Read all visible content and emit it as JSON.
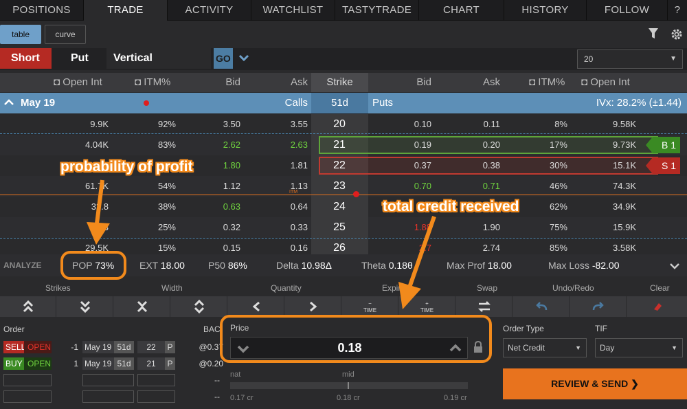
{
  "nav": {
    "tabs": [
      "POSITIONS",
      "TRADE",
      "ACTIVITY",
      "WATCHLIST",
      "TASTYTRADE",
      "CHART",
      "HISTORY",
      "FOLLOW",
      "?"
    ],
    "active": "TRADE"
  },
  "view": {
    "table": "table",
    "curve": "curve"
  },
  "strategy": {
    "short": "Short",
    "put": "Put",
    "vertical": "Vertical",
    "go": "GO",
    "strikes_count": "20"
  },
  "chain_header": {
    "open_int": "Open Int",
    "itm": "ITM%",
    "bid": "Bid",
    "ask": "Ask",
    "strike": "Strike",
    "put_bid": "Bid",
    "put_ask": "Ask",
    "put_itm": "ITM%",
    "put_open_int": "Open Int"
  },
  "expiry": {
    "date": "May 19",
    "calls": "Calls",
    "dte": "51d",
    "puts": "Puts",
    "ivx": "IVx: 28.2% (±1.44)"
  },
  "rows": [
    {
      "c_oi": "9.9K",
      "c_itm": "92%",
      "c_bid": "3.50",
      "c_ask": "3.55",
      "strike": "20",
      "p_bid": "0.10",
      "p_ask": "0.11",
      "p_itm": "8%",
      "p_oi": "9.58K",
      "pos": ""
    },
    {
      "c_oi": "4.04K",
      "c_itm": "83%",
      "c_bid": "2.62",
      "c_ask": "2.63",
      "strike": "21",
      "p_bid": "0.19",
      "p_ask": "0.20",
      "p_itm": "17%",
      "p_oi": "9.73K",
      "pos": "B 1"
    },
    {
      "c_oi": "",
      "c_itm": "",
      "c_bid": "1.80",
      "c_ask": "1.81",
      "strike": "22",
      "p_bid": "0.37",
      "p_ask": "0.38",
      "p_itm": "30%",
      "p_oi": "15.1K",
      "pos": "S 1"
    },
    {
      "c_oi": "61.7K",
      "c_itm": "54%",
      "c_bid": "1.12",
      "c_ask": "1.13",
      "strike": "23",
      "p_bid": "0.70",
      "p_ask": "0.71",
      "p_itm": "46%",
      "p_oi": "74.3K",
      "pos": ""
    },
    {
      "c_oi": "32.8",
      "c_itm": "38%",
      "c_bid": "0.63",
      "c_ask": "0.64",
      "strike": "24",
      "p_bid": "",
      "p_ask": "",
      "p_itm": "62%",
      "p_oi": "34.9K",
      "pos": ""
    },
    {
      "c_oi": "13",
      "c_itm": "25%",
      "c_bid": "0.32",
      "c_ask": "0.33",
      "strike": "25",
      "p_bid": "1.88",
      "p_ask": "1.90",
      "p_itm": "75%",
      "p_oi": "15.9K",
      "pos": ""
    },
    {
      "c_oi": "29.5K",
      "c_itm": "15%",
      "c_bid": "0.15",
      "c_ask": "0.16",
      "strike": "26",
      "p_bid": "2.7",
      "p_ask": "2.74",
      "p_itm": "85%",
      "p_oi": "3.58K",
      "pos": ""
    }
  ],
  "itm_label": "ITM",
  "analyze": {
    "label": "ANALYZE",
    "pop_label": "POP",
    "pop": "73%",
    "ext_label": "EXT",
    "ext": "18.00",
    "p50_label": "P50",
    "p50": "86%",
    "delta_label": "Delta",
    "delta": "10.98Δ",
    "theta_label": "Theta",
    "theta": "0.18θ",
    "maxprof_label": "Max Prof",
    "maxprof": "18.00",
    "maxloss_label": "Max Loss",
    "maxloss": "-82.00"
  },
  "controls": {
    "strikes": "Strikes",
    "width": "Width",
    "quantity": "Quantity",
    "expiration": "Expira",
    "swap": "Swap",
    "undoredo": "Undo/Redo",
    "clear": "Clear",
    "time": "TIME"
  },
  "order": {
    "label": "Order",
    "bac": "BAC",
    "price_label": "Price",
    "price": "0.18",
    "legs": [
      {
        "side": "SELL",
        "action": "OPEN",
        "qty": "-1",
        "exp": "May 19",
        "dte": "51d",
        "strike": "22",
        "type": "P",
        "bac": "@0.37"
      },
      {
        "side": "BUY",
        "action": "OPEN",
        "qty": "1",
        "exp": "May 19",
        "dte": "51d",
        "strike": "21",
        "type": "P",
        "bac": "@0.20"
      }
    ],
    "dash1": "--",
    "dash2": "--",
    "nat": "nat",
    "mid": "mid",
    "nat_val": "0.17 cr",
    "mid_val": "0.18 cr",
    "far_val": "0.19 cr",
    "order_type_label": "Order Type",
    "order_type": "Net Credit",
    "tif_label": "TIF",
    "tif": "Day",
    "review": "REVIEW & SEND"
  },
  "annotations": {
    "pop": "probability of profit",
    "credit": "total credit received"
  },
  "colors": {
    "accent": "#f28a1c",
    "short": "#b52a23",
    "expiry_bar": "#5d8fb7",
    "buy": "#3a8a23"
  }
}
